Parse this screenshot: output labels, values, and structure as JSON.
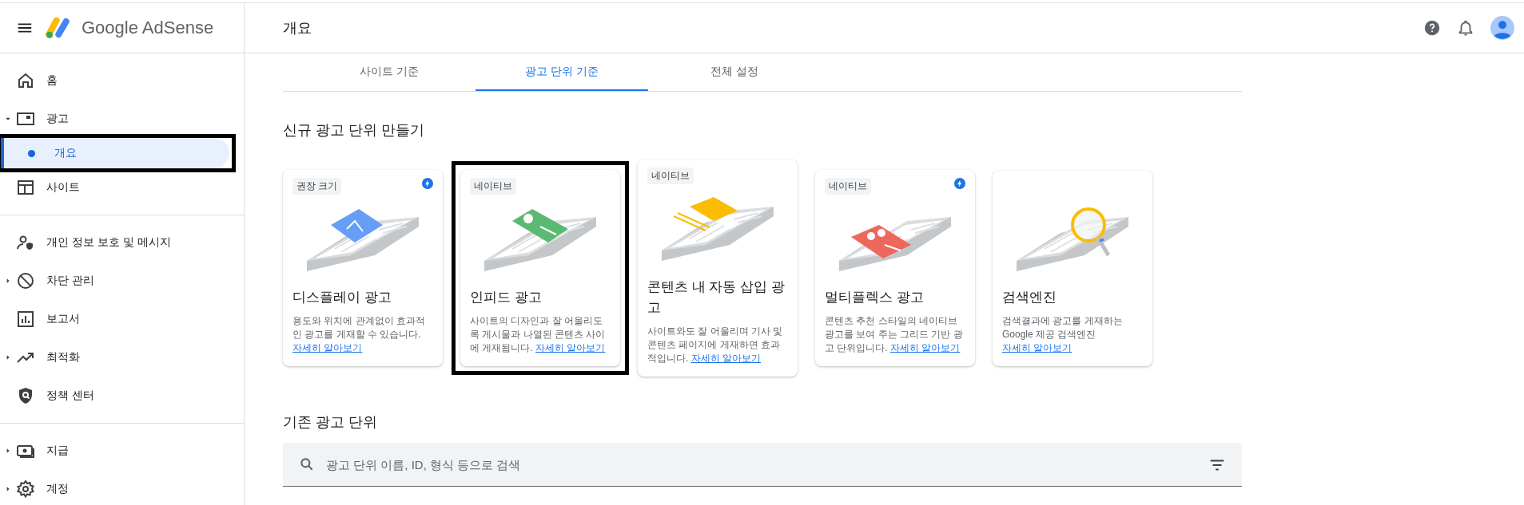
{
  "header": {
    "product": "Google AdSense",
    "page_title": "개요"
  },
  "sidebar": {
    "groups": [
      [
        {
          "label": "홈",
          "kind": "link",
          "selected": false
        },
        {
          "label": "광고",
          "kind": "expandable",
          "expanded": true,
          "selected": false,
          "children": [
            {
              "label": "개요",
              "selected": true,
              "highlighted": true
            }
          ]
        },
        {
          "label": "사이트",
          "kind": "link",
          "selected": false
        }
      ],
      [
        {
          "label": "개인 정보 보호 및 메시지",
          "kind": "link",
          "selected": false
        },
        {
          "label": "차단 관리",
          "kind": "expandable",
          "expanded": false,
          "selected": false
        },
        {
          "label": "보고서",
          "kind": "link",
          "selected": false
        },
        {
          "label": "최적화",
          "kind": "expandable",
          "expanded": false,
          "selected": false
        },
        {
          "label": "정책 센터",
          "kind": "link",
          "selected": false
        }
      ],
      [
        {
          "label": "지급",
          "kind": "expandable",
          "expanded": false,
          "selected": false
        },
        {
          "label": "계정",
          "kind": "expandable",
          "expanded": false,
          "selected": false
        }
      ]
    ]
  },
  "tabs": [
    {
      "label": "사이트 기준",
      "selected": false
    },
    {
      "label": "광고 단위 기준",
      "selected": true
    },
    {
      "label": "전체 설정",
      "selected": false
    }
  ],
  "create_section": {
    "title": "신규 광고 단위 만들기",
    "cards": [
      {
        "badge": "권장 크기",
        "amp": true,
        "highlighted": false,
        "title": "디스플레이 광고",
        "description": "용도와 위치에 관계없이 효과적인 광고를 게재할 수 있습니다. ",
        "link": "자세히 알아보기"
      },
      {
        "badge": "네이티브",
        "amp": false,
        "highlighted": true,
        "title": "인피드 광고",
        "description": "사이트의 디자인과 잘 어울리도록 게시물과 나열된 콘텐츠 사이에 게재됩니다. ",
        "link": "자세히 알아보기"
      },
      {
        "badge": "네이티브",
        "amp": false,
        "highlighted": false,
        "title": "콘텐츠 내 자동 삽입 광고",
        "description": "사이트와도 잘 어울리며 기사 및 콘텐츠 페이지에 게재하면 효과적입니다. ",
        "link": "자세히 알아보기"
      },
      {
        "badge": "네이티브",
        "amp": true,
        "highlighted": false,
        "title": "멀티플렉스 광고",
        "description": "콘텐츠 추천 스타일의 네이티브 광고를 보여 주는 그리드 기반 광고 단위입니다. ",
        "link": "자세히 알아보기"
      },
      {
        "amp": false,
        "highlighted": false,
        "title": "검색엔진",
        "description": "검색결과에 광고를 게재하는 Google 제공 검색엔진 ",
        "link": "자세히 알아보기"
      }
    ]
  },
  "existing_section": {
    "title": "기존 광고 단위",
    "search": {
      "placeholder": "광고 단위 이름, ID, 형식 등으로 검색"
    }
  }
}
